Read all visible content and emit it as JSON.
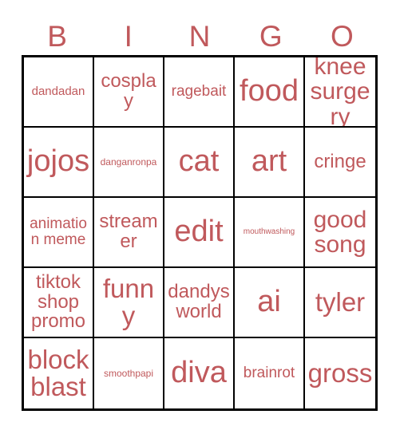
{
  "card": {
    "title": "BINGO",
    "text_color": "#c0595c",
    "grid_line_color": "#000000",
    "background_color": "#ffffff",
    "columns": 5,
    "rows": 5
  },
  "header": {
    "letters": [
      {
        "label": "B"
      },
      {
        "label": "I"
      },
      {
        "label": "N"
      },
      {
        "label": "G"
      },
      {
        "label": "O"
      }
    ]
  },
  "grid": {
    "rows": [
      {
        "cells": [
          {
            "label": "dandadan",
            "size": "xs"
          },
          {
            "label": "cosplay",
            "size": "m"
          },
          {
            "label": "ragebait",
            "size": "s"
          },
          {
            "label": "food",
            "size": "xxl"
          },
          {
            "label": "knee surgery",
            "size": "l"
          }
        ]
      },
      {
        "cells": [
          {
            "label": "jojos",
            "size": "xxl"
          },
          {
            "label": "danganronpa",
            "size": "xxs"
          },
          {
            "label": "cat",
            "size": "xxl"
          },
          {
            "label": "art",
            "size": "xxl"
          },
          {
            "label": "cringe",
            "size": "m"
          }
        ]
      },
      {
        "cells": [
          {
            "label": "animation meme",
            "size": "s"
          },
          {
            "label": "streamer",
            "size": "m"
          },
          {
            "label": "edit",
            "size": "xxl"
          },
          {
            "label": "mouthwashing",
            "size": "tiny"
          },
          {
            "label": "good song",
            "size": "l"
          }
        ]
      },
      {
        "cells": [
          {
            "label": "tiktok shop promo",
            "size": "m"
          },
          {
            "label": "funny",
            "size": "xl"
          },
          {
            "label": "dandys world",
            "size": "m"
          },
          {
            "label": "ai",
            "size": "xxl"
          },
          {
            "label": "tyler",
            "size": "xl"
          }
        ]
      },
      {
        "cells": [
          {
            "label": "block blast",
            "size": "xl"
          },
          {
            "label": "smoothpapi",
            "size": "xxs"
          },
          {
            "label": "diva",
            "size": "xxl"
          },
          {
            "label": "brainrot",
            "size": "s"
          },
          {
            "label": "gross",
            "size": "xl"
          }
        ]
      }
    ]
  }
}
